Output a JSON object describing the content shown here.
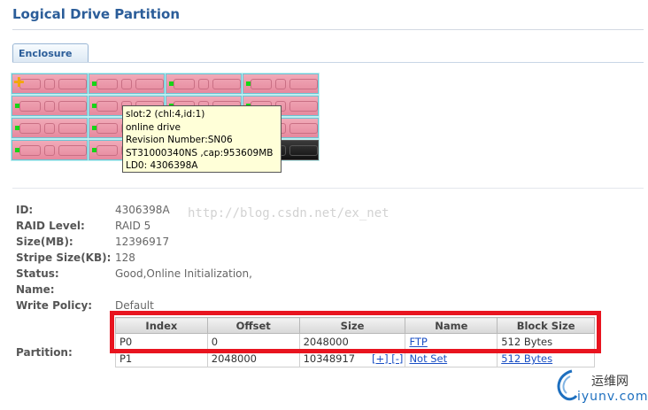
{
  "page": {
    "title": "Logical Drive Partition"
  },
  "tab": {
    "label": "Enclosure"
  },
  "enclosure": {
    "slot_color": "#ee9eb0",
    "led_color": "#17d417",
    "hotspare_color": "#f3a70a"
  },
  "tooltip": {
    "line1": "slot:2 (chl:4,id:1)",
    "line2": "online drive",
    "line3": "Revision Number:SN06",
    "line4": "ST31000340NS ,cap:953609MB",
    "line5": "LD0: 4306398A"
  },
  "props": {
    "id_label": "ID:",
    "id_value": "4306398A",
    "raid_label": "RAID Level:",
    "raid_value": "RAID 5",
    "size_label": "Size(MB):",
    "size_value": "12396917",
    "stripe_label": "Stripe Size(KB):",
    "stripe_value": "128",
    "status_label": "Status:",
    "status_value": "Good,Online Initialization,",
    "name_label": "Name:",
    "write_label": "Write Policy:",
    "write_value": "Default",
    "partition_label": "Partition:"
  },
  "partition_table": {
    "headers": [
      "Index",
      "Offset",
      "Size",
      "Name",
      "Block Size"
    ],
    "rows": [
      {
        "index": "P0",
        "offset": "0",
        "size": "2048000",
        "controls": "",
        "name": "FTP",
        "block_size": "512 Bytes"
      },
      {
        "index": "P1",
        "offset": "2048000",
        "size": "10348917",
        "controls": "[+] [-]",
        "name": "Not Set",
        "block_size": "512 Bytes"
      }
    ]
  },
  "watermark": {
    "text": "http://blog.csdn.net/ex_net"
  },
  "logo": {
    "top": "运维网",
    "bottom": "iyunv.com"
  },
  "colors": {
    "title": "#2b5d99",
    "highlight": "#e8141f",
    "link": "#1a4fc4"
  }
}
